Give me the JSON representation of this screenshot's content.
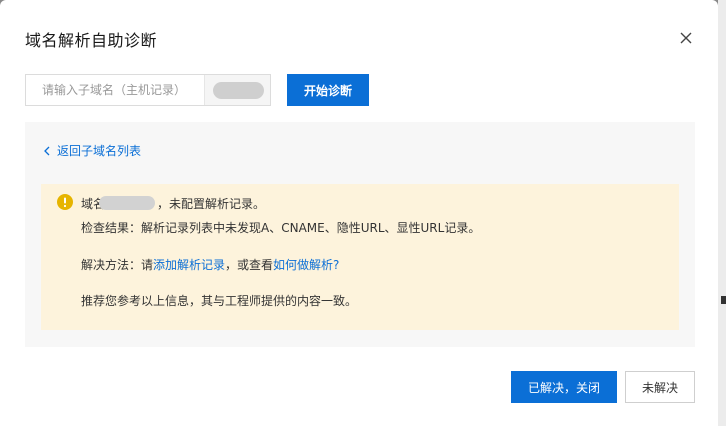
{
  "dialog": {
    "title": "域名解析自助诊断"
  },
  "search": {
    "placeholder": "请输入子域名（主机记录）",
    "diagnose_label": "开始诊断"
  },
  "result": {
    "back_label": "返回子域名列表",
    "line1_prefix": "域名",
    "line1_suffix": "，未配置解析记录。",
    "line2": "检查结果：解析记录列表中未发现A、CNAME、隐性URL、显性URL记录。",
    "line3_prefix": "解决方法：请",
    "line3_link1": "添加解析记录",
    "line3_middle": "，或查看",
    "line3_link2": "如何做解析?",
    "line4": "推荐您参考以上信息，其与工程师提供的内容一致。"
  },
  "footer": {
    "resolved_label": "已解决，关闭",
    "unresolved_label": "未解决"
  },
  "colors": {
    "primary": "#0b6fd6",
    "warning": "#e6b400",
    "notice_bg": "#fdf3dc"
  },
  "icons": {
    "close": "close-icon",
    "back": "chevron-left-icon",
    "warning": "warning-icon"
  }
}
